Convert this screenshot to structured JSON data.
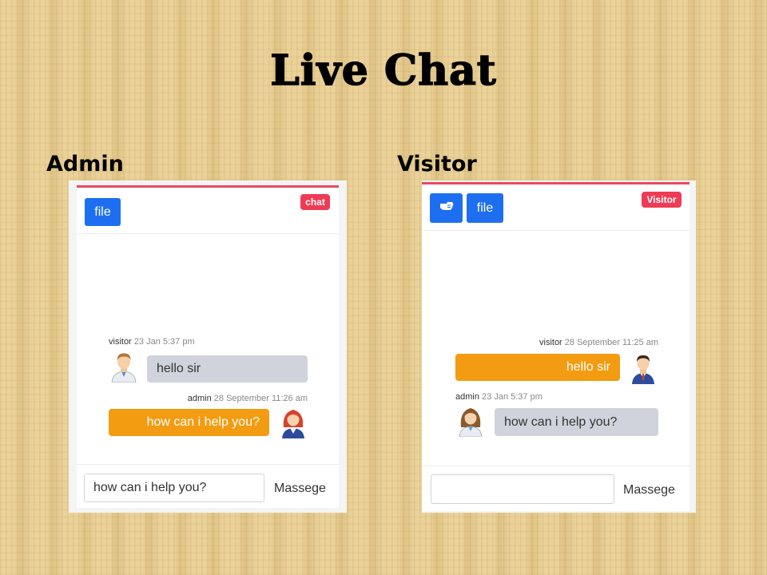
{
  "title": "Live Chat",
  "admin": {
    "label": "Admin",
    "file_button": "file",
    "badge": "chat",
    "messages": [
      {
        "sender": "visitor",
        "time": "23 Jan 5:37 pm",
        "text": "hello sir"
      },
      {
        "sender": "admin",
        "time": "28 September 11:26 am",
        "text": "how can i help you?"
      }
    ],
    "input_value": "how can i help you?",
    "send_label": "Massege"
  },
  "visitor": {
    "label": "Visitor",
    "file_button": "file",
    "badge": "Visitor",
    "messages": [
      {
        "sender": "visitor",
        "time": "28 September 11:25 am",
        "text": "hello sir"
      },
      {
        "sender": "admin",
        "time": "23 Jan 5:37 pm",
        "text": "how can i help you?"
      }
    ],
    "input_value": "",
    "send_label": "Massege"
  },
  "colors": {
    "primary_button": "#1e6ff0",
    "badge": "#ef3b55",
    "outgoing_bubble": "#f39c12",
    "incoming_bubble": "#d0d3db",
    "card_top_border": "#e84a5f"
  }
}
